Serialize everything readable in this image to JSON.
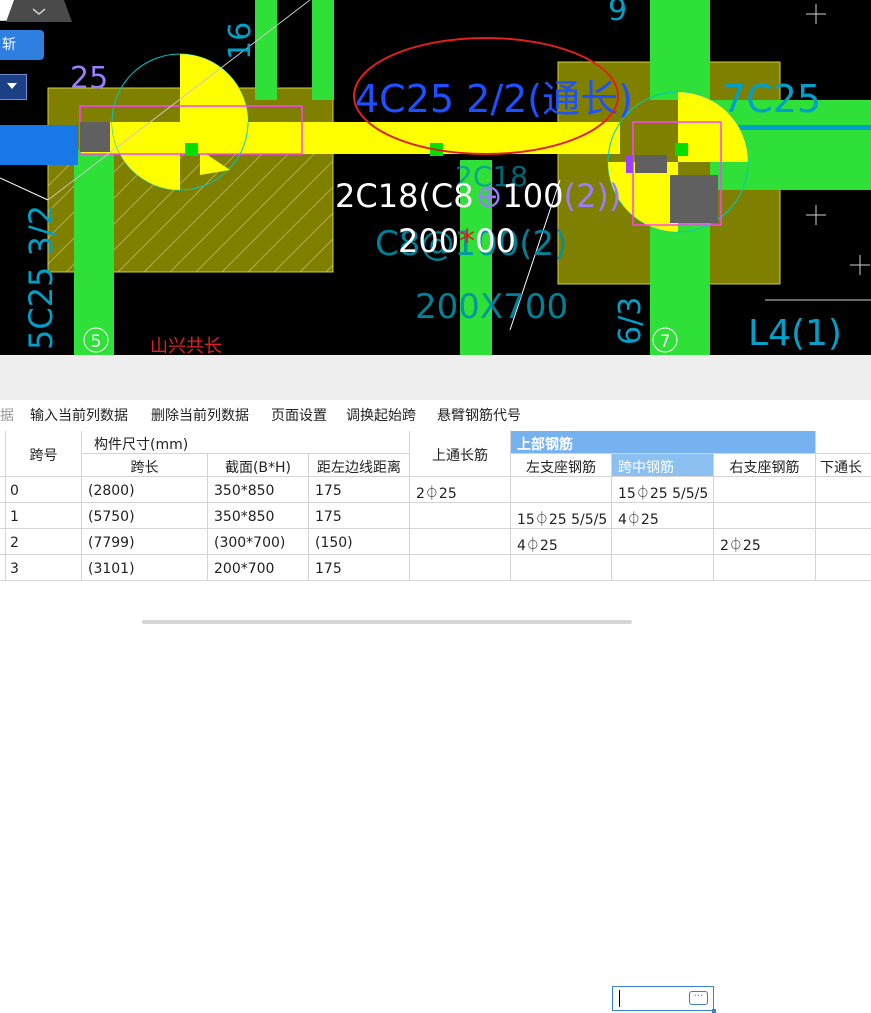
{
  "colors": {
    "cad_background": "#000000",
    "column_green": "#2fe038",
    "beam_yellow": "#ffff00",
    "pad_olive": "#808000",
    "annotation_cyan": "#00b4c8",
    "annotation_white": "#ffffff",
    "annotation_purple": "#a070ff",
    "markup_red": "#e02020",
    "header_blue": "#75b2ef"
  },
  "cad": {
    "popup_button_label": "斩",
    "popup_partial_text": "25",
    "beam_annotation": "4C25 2/2(通长)",
    "beam_left_annotation": "5C25",
    "beam_right_annotation": "7C25",
    "left_column_label": "5C25 3/2",
    "left_column_label2": "16",
    "beam_label_line1": "2C18(C8",
    "beam_label_line1_mid": "100",
    "beam_label_line1_paren": "(2))",
    "beam_label_line2": "200",
    "beam_label_line2_tail": "00",
    "ghost_label_1": "C8@100(2)",
    "ghost_label_2": "200X700",
    "ghost_label_3": "2C18",
    "right_column_label": "6/3",
    "right_text": "L4(1)",
    "grid_marker_5": "5",
    "grid_marker_7": "7",
    "bottom_red_text": "山兴共长",
    "top_right_partial": "9",
    "collapse_icon_glyph": "⌄"
  },
  "toolbar": {
    "cut_off_item": "据",
    "items": [
      "输入当前列数据",
      "删除当前列数据",
      "页面设置",
      "调换起始跨",
      "悬臂钢筋代号"
    ]
  },
  "table": {
    "headers": {
      "span_no": "跨号",
      "component_size": "构件尺寸(mm)",
      "span_length": "跨长",
      "section": "截面(B*H)",
      "offset": "距左边线距离",
      "top_through": "上通长筋",
      "top_rebar": "上部钢筋",
      "left_support": "左支座钢筋",
      "mid_span": "跨中钢筋",
      "right_support": "右支座钢筋",
      "bottom_through": "下通长"
    },
    "rows": [
      {
        "span_no": "0",
        "span_length": "(2800)",
        "section": "350*850",
        "offset": "175",
        "top_through": "2⏀25",
        "left_support": "",
        "mid_span": "15⏀25 5/5/5",
        "right_support": "",
        "bottom_through": ""
      },
      {
        "span_no": "1",
        "span_length": "(5750)",
        "section": "350*850",
        "offset": "175",
        "top_through": "",
        "left_support": "15⏀25 5/5/5",
        "mid_span": "4⏀25",
        "right_support": "",
        "bottom_through": ""
      },
      {
        "span_no": "2",
        "span_length": "(7799)",
        "section": "(300*700)",
        "offset": "(150)",
        "top_through": "",
        "left_support": "4⏀25",
        "mid_span": "",
        "right_support": "2⏀25",
        "bottom_through": ""
      },
      {
        "span_no": "3",
        "span_length": "(3101)",
        "section": "200*700",
        "offset": "175",
        "top_through": "",
        "left_support": "",
        "mid_span": "",
        "right_support": "",
        "bottom_through": ""
      }
    ],
    "editor_button": "···"
  }
}
